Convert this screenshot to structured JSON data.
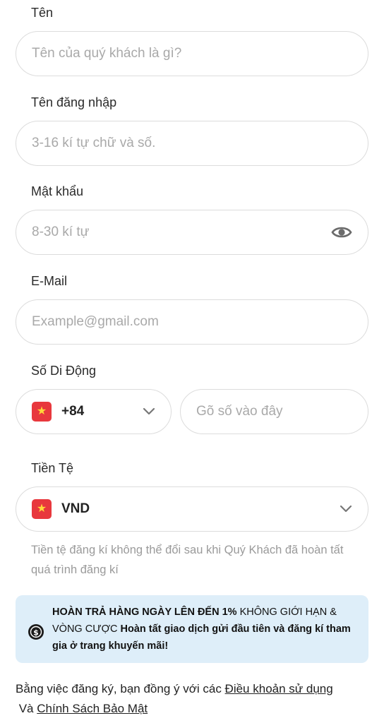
{
  "name": {
    "label": "Tên",
    "placeholder": "Tên của quý khách là gì?"
  },
  "username": {
    "label": "Tên đăng nhập",
    "placeholder": "3-16 kí tự chữ và số."
  },
  "password": {
    "label": "Mật khẩu",
    "placeholder": "8-30 kí tự",
    "toggle_icon": "eye-icon"
  },
  "email": {
    "label": "E-Mail",
    "placeholder": "Example@gmail.com"
  },
  "phone": {
    "label": "Số Di Động",
    "country_code": "+84",
    "placeholder": "Gõ số vào đây",
    "flag_icon": "vietnam-flag-icon"
  },
  "currency": {
    "label": "Tiền Tệ",
    "selected": "VND",
    "flag_icon": "vietnam-flag-icon",
    "note": "Tiền tệ đăng kí không thể đổi sau khi Quý Khách đã hoàn tất quá trình đăng kí"
  },
  "promo": {
    "icon": "cashback-icon",
    "part1_bold": "HOÀN TRẢ HÀNG NGÀY LÊN ĐẾN 1%",
    "part2": " KHÔNG GIỚI HẠN & VÒNG CƯỢC ",
    "part3_bold": "Hoàn tất giao dịch gửi đầu tiên và đăng kí tham gia ở trang khuyến mãi!"
  },
  "terms": {
    "prefix": "Bằng việc đăng ký, bạn đồng ý với các ",
    "terms_link": "Điều khoản sử dụng",
    "conjunction": " Và ",
    "privacy_link": "Chính Sách Bảo Mật"
  },
  "colors": {
    "border": "#dcdcdc",
    "placeholder": "#a9a9a9",
    "flag_red": "#e8383d",
    "flag_star": "#ffd83a",
    "promo_bg": "#deeef9"
  }
}
